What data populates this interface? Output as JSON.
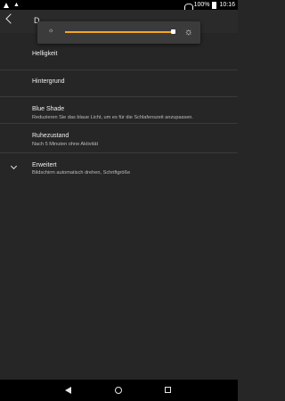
{
  "status_bar": {
    "battery": "100%",
    "time": "10:16",
    "icons": [
      "warning-icon",
      "notification-icon",
      "wifi-icon",
      "battery-icon"
    ]
  },
  "app_bar": {
    "title": "D"
  },
  "brightness": {
    "level": 1.0,
    "accent_color": "#f5a623"
  },
  "settings": {
    "items": [
      {
        "title": "Helligkeit",
        "subtitle": ""
      },
      {
        "title": "Hintergrund",
        "subtitle": ""
      },
      {
        "title": "Blue Shade",
        "subtitle": "Reduzieren Sie das blaue Licht, um es für die Schlafenszeit anzupassen."
      },
      {
        "title": "Ruhezustand",
        "subtitle": "Nach 5 Minuten ohne Aktivität"
      },
      {
        "title": "Erweitert",
        "subtitle": "Bildschirm automatisch drehen, Schriftgröße"
      }
    ]
  }
}
